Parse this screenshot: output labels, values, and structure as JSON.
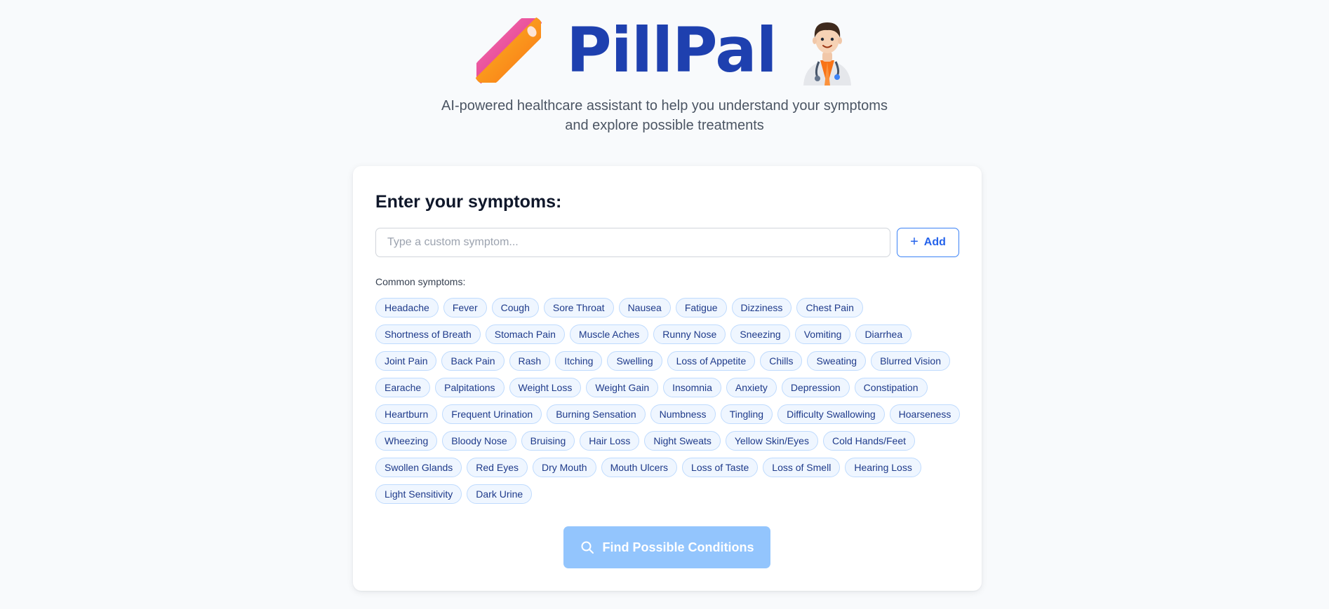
{
  "app": {
    "title": "PillPal",
    "subtitle_line1": "AI-powered healthcare assistant to help you understand your symptoms",
    "subtitle_line2": "and explore possible treatments",
    "logo_icon": "pill-icon",
    "mascot_icon": "doctor-icon",
    "brand_color": "#1e40af"
  },
  "symptom_form": {
    "heading": "Enter your symptoms:",
    "input_placeholder": "Type a custom symptom...",
    "input_value": "",
    "add_label": "Add",
    "add_icon": "plus-icon",
    "common_label": "Common symptoms:",
    "common_symptoms": [
      "Headache",
      "Fever",
      "Cough",
      "Sore Throat",
      "Nausea",
      "Fatigue",
      "Dizziness",
      "Chest Pain",
      "Shortness of Breath",
      "Stomach Pain",
      "Muscle Aches",
      "Runny Nose",
      "Sneezing",
      "Vomiting",
      "Diarrhea",
      "Joint Pain",
      "Back Pain",
      "Rash",
      "Itching",
      "Swelling",
      "Loss of Appetite",
      "Chills",
      "Sweating",
      "Blurred Vision",
      "Earache",
      "Palpitations",
      "Weight Loss",
      "Weight Gain",
      "Insomnia",
      "Anxiety",
      "Depression",
      "Constipation",
      "Heartburn",
      "Frequent Urination",
      "Burning Sensation",
      "Numbness",
      "Tingling",
      "Difficulty Swallowing",
      "Hoarseness",
      "Wheezing",
      "Bloody Nose",
      "Bruising",
      "Hair Loss",
      "Night Sweats",
      "Yellow Skin/Eyes",
      "Cold Hands/Feet",
      "Swollen Glands",
      "Red Eyes",
      "Dry Mouth",
      "Mouth Ulcers",
      "Loss of Taste",
      "Loss of Smell",
      "Hearing Loss",
      "Light Sensitivity",
      "Dark Urine"
    ],
    "submit_label": "Find Possible Conditions",
    "submit_icon": "search-icon",
    "submit_color": "#93c5fd"
  }
}
